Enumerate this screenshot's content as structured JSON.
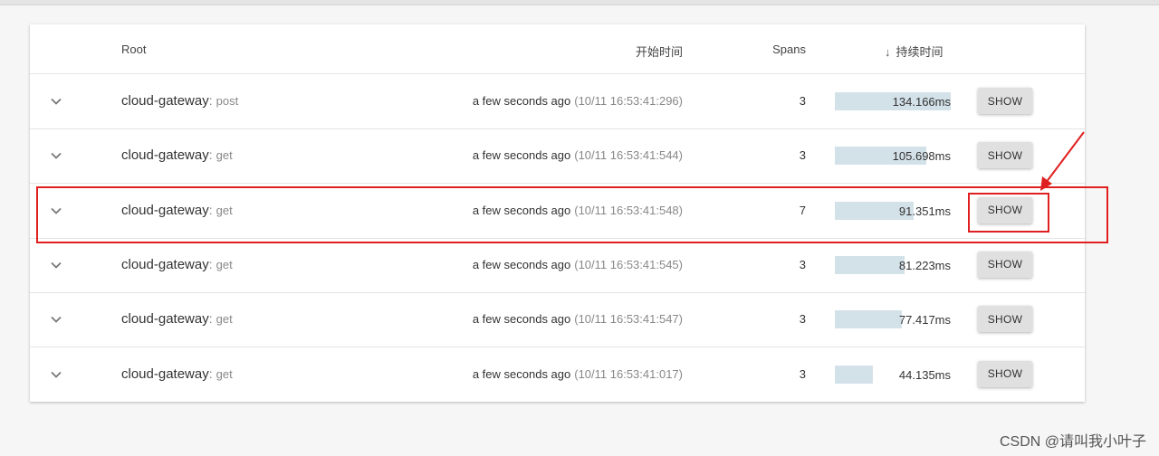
{
  "table": {
    "headers": {
      "root": "Root",
      "start_time": "开始时间",
      "spans": "Spans",
      "duration": "持续时间"
    },
    "rows": [
      {
        "service": "cloud-gateway",
        "separator": ":",
        "operation": "post",
        "relative": "a few seconds ago",
        "absolute": "(10/11 16:53:41:296)",
        "spans": "3",
        "duration": "134.166ms",
        "duration_fraction": 1.0,
        "action": "SHOW"
      },
      {
        "service": "cloud-gateway",
        "separator": ":",
        "operation": "get",
        "relative": "a few seconds ago",
        "absolute": "(10/11 16:53:41:544)",
        "spans": "3",
        "duration": "105.698ms",
        "duration_fraction": 0.788,
        "action": "SHOW"
      },
      {
        "service": "cloud-gateway",
        "separator": ":",
        "operation": "get",
        "relative": "a few seconds ago",
        "absolute": "(10/11 16:53:41:548)",
        "spans": "7",
        "duration": "91.351ms",
        "duration_fraction": 0.681,
        "action": "SHOW"
      },
      {
        "service": "cloud-gateway",
        "separator": ":",
        "operation": "get",
        "relative": "a few seconds ago",
        "absolute": "(10/11 16:53:41:545)",
        "spans": "3",
        "duration": "81.223ms",
        "duration_fraction": 0.605,
        "action": "SHOW"
      },
      {
        "service": "cloud-gateway",
        "separator": ":",
        "operation": "get",
        "relative": "a few seconds ago",
        "absolute": "(10/11 16:53:41:547)",
        "spans": "3",
        "duration": "77.417ms",
        "duration_fraction": 0.577,
        "action": "SHOW"
      },
      {
        "service": "cloud-gateway",
        "separator": ":",
        "operation": "get",
        "relative": "a few seconds ago",
        "absolute": "(10/11 16:53:41:017)",
        "spans": "3",
        "duration": "44.135ms",
        "duration_fraction": 0.329,
        "action": "SHOW"
      }
    ]
  },
  "annotation": {
    "highlighted_row": 2,
    "color": "#e02020"
  },
  "colors": {
    "bar": "#d3e1e8",
    "button": "#e0e0e0"
  },
  "watermark": "CSDN @请叫我小叶子"
}
